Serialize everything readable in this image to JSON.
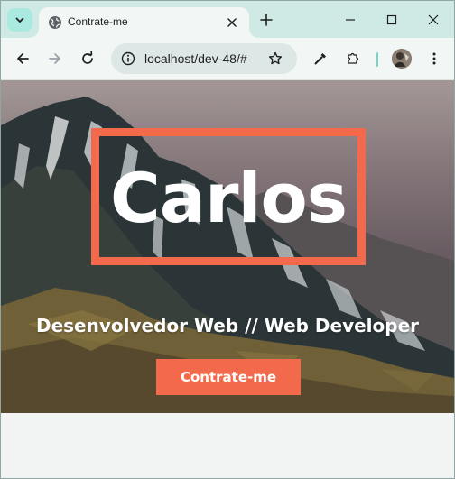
{
  "browser": {
    "tab": {
      "title": "Contrate-me",
      "favicon": "globe-icon"
    },
    "address_bar": {
      "url": "localhost/dev-48/#"
    },
    "colors": {
      "tabstrip": "#cfe9e4",
      "toolbar": "#f2f6f5",
      "accent": "#a9e9df"
    }
  },
  "page": {
    "hero": {
      "name": "Carlos",
      "subtitle": "Desenvolvedor Web // Web Developer",
      "cta_label": "Contrate-me"
    },
    "colors": {
      "accent": "#f26a4b",
      "text": "#ffffff"
    }
  }
}
